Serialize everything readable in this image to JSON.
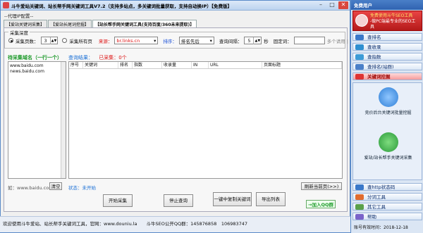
{
  "window": {
    "title": "斗牛爱站关键词、站长帮手网关键词工具V7.2（支持多站点，多关键词批量获取，支持自动换IP）【免费版】",
    "minimize": "–",
    "maximize": "□",
    "close": "✕"
  },
  "proxy_config": "--代理IP配置--",
  "tabs": [
    "【爱站关键词采集】",
    "【爱站长尾词挖掘】",
    "【站长帮手网关键词工具(支持百度/360未来提取)】"
  ],
  "form": {
    "legend": "采集深度",
    "by_pages_label": "采集页数：",
    "pages_value": "3",
    "all_pages_label": "采集所有页",
    "source_label": "来源：",
    "source_value": "br.links.cn",
    "sort_label": "排序：",
    "sort_value": "排名先后",
    "interval_label": "查询间隔：",
    "interval_value": "5",
    "interval_unit": "秒",
    "filter_label": "固定词：",
    "filter_hint": "多个请用 | 分开"
  },
  "keywords": {
    "label": "待采集域名（一行一个）",
    "lines": [
      "www.baidu.com",
      "news.baidu.com"
    ],
    "example": "如：www.baidu.com",
    "clear_button": "清空"
  },
  "status_top": {
    "query_status": "查询结果：",
    "collected": "已采集：0个"
  },
  "grid": {
    "columns": [
      "序号",
      "关键词",
      "排名",
      "指数",
      "收录量",
      "IN",
      "URL",
      "页面标题"
    ]
  },
  "status_bottom": "状态：未开始",
  "buttons": {
    "start": "开始采集",
    "stop": "停止查询",
    "copy": "一键中复制关键词",
    "export": "导出列表",
    "refresh": "刷新当前页(>>)",
    "join_qq": "→加入QQ群"
  },
  "statusbar": "欢迎使用斗牛爱站、站长帮手关键词工具，官网：www.douniu.la　　斗牛SEO公开QQ群：145876858　106983747",
  "right_panel": {
    "title": "免费用户",
    "user_line1": "免费使用斗牛SEO工具",
    "user_line2": "-做PC端最专业的SEO工具",
    "items_top": [
      "查排名",
      "查收录",
      "查指数",
      "查排名(站群)",
      "关键词挖掘"
    ],
    "big_buttons": [
      "竞价后台关键词批量挖掘",
      "爱站/站长帮手关键词采集"
    ],
    "items_bottom": [
      "查http状态码",
      "分词工具",
      "其它工具",
      "帮助"
    ],
    "expiry": "账号有效时间：2018-12-18"
  },
  "colors": {
    "accent_blue": "#1a6fd6",
    "accent_red": "#d11",
    "accent_green": "#1d9a2a",
    "brand_red": "#c62828"
  }
}
